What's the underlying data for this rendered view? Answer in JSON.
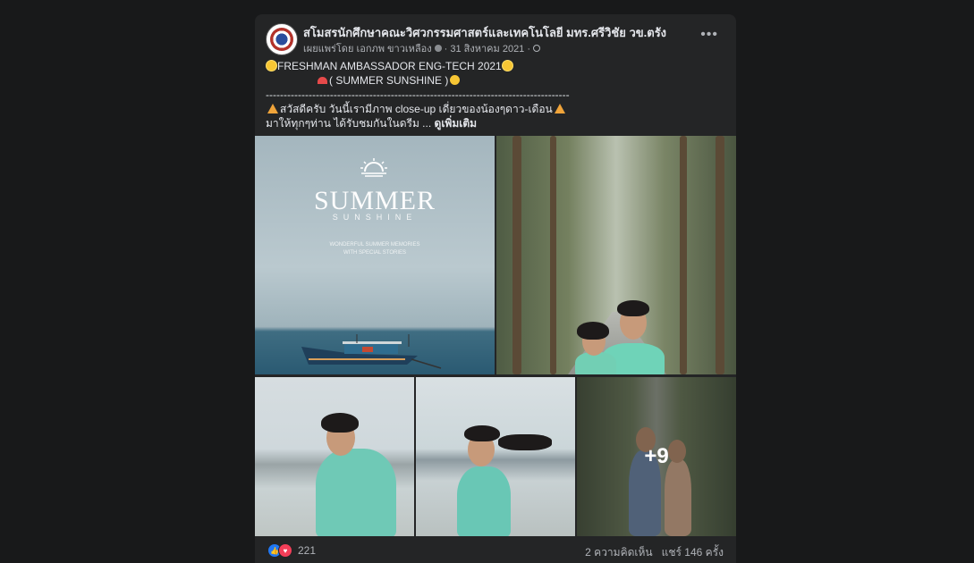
{
  "post": {
    "page_name": "สโมสรนักศึกษาคณะวิศวกรรมศาสตร์และเทคโนโลยี มทร.ศรีวิชัย วข.ตรัง",
    "meta_prefix": "เผยแพร่โดย เอกภพ ขาวเหลือง",
    "date": "· 31 สิงหาคม 2021 ·",
    "more_label": "•••",
    "icons": {
      "menu": "more-horizontal-icon",
      "privacy": "globe-icon",
      "info": "info-icon"
    },
    "text": {
      "line1": "FRESHMAN AMBASSADOR ENG-TECH 2021",
      "line2": "( SUMMER SUNSHINE )",
      "divider": "-------------------------------------------------------------------------------------",
      "line3": "สวัสดีครับ วันนี้เรามีภาพ close-up เดี่ยวของน้องๆดาว-เดือน",
      "line4": "มาให้ทุกๆท่าน ได้รับชมกันในดรีม ...",
      "see_more": "ดูเพิ่มเติม"
    },
    "photos": {
      "summer_title": "SUMMER",
      "summer_sub": "SUNSHINE",
      "summer_small1": "WONDERFUL SUMMER MEMORIES",
      "summer_small2": "WITH SPECIAL STORIES",
      "more_count": "+9"
    },
    "footer": {
      "reaction_count": "221",
      "comments": "2 ความคิดเห็น",
      "shares": "แชร์ 146 ครั้ง"
    },
    "colors": {
      "background": "#18191a",
      "card": "#242526",
      "text": "#e4e6eb",
      "secondary_text": "#b0b3b8",
      "like_blue": "#2078f4",
      "love_red": "#f33e58"
    }
  }
}
